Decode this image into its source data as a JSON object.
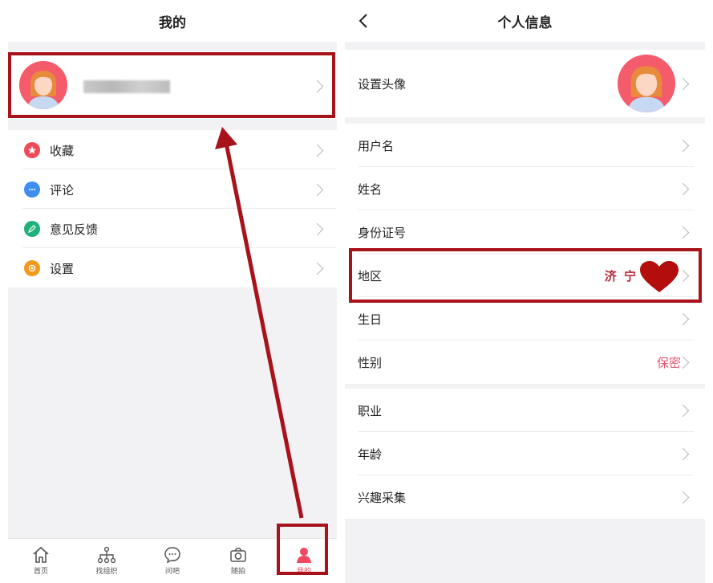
{
  "left": {
    "header": {
      "title": "我的"
    },
    "menu": [
      {
        "label": "收藏",
        "icon": "star-icon",
        "color": "#ef4a57"
      },
      {
        "label": "评论",
        "icon": "comment-icon",
        "color": "#3e8ef0"
      },
      {
        "label": "意见反馈",
        "icon": "edit-feedback-icon",
        "color": "#22b07a"
      },
      {
        "label": "设置",
        "icon": "gear-icon",
        "color": "#f39a1c"
      }
    ],
    "tabbar": [
      {
        "label": "首页",
        "icon": "home-icon"
      },
      {
        "label": "找组织",
        "icon": "organization-icon"
      },
      {
        "label": "问吧",
        "icon": "chat-icon"
      },
      {
        "label": "随拍",
        "icon": "camera-icon"
      },
      {
        "label": "我的",
        "icon": "person-icon",
        "active": true
      }
    ]
  },
  "right": {
    "header": {
      "title": "个人信息"
    },
    "avatar_row": {
      "label": "设置头像"
    },
    "group1": [
      {
        "label": "用户名",
        "value": ""
      },
      {
        "label": "姓名",
        "value": ""
      },
      {
        "label": "身份证号",
        "value": ""
      },
      {
        "label": "地区",
        "value": "济 宁"
      },
      {
        "label": "生日",
        "value": ""
      },
      {
        "label": "性别",
        "value": "保密"
      }
    ],
    "group2": [
      {
        "label": "职业"
      },
      {
        "label": "年龄"
      },
      {
        "label": "兴趣采集"
      }
    ]
  },
  "colors": {
    "accent": "#f0485f",
    "annotation": "#a8121b",
    "avatar_bg": "#f45c6c"
  }
}
